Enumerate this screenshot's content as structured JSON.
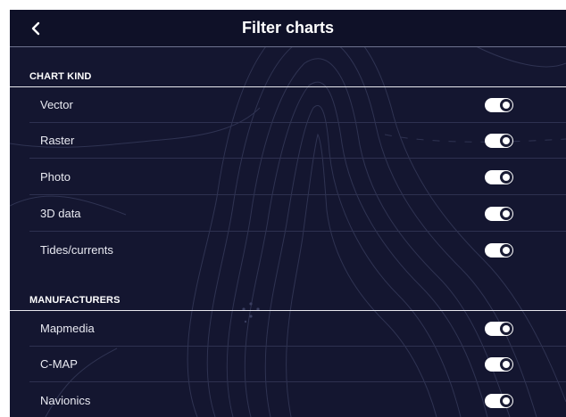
{
  "header": {
    "title": "Filter charts",
    "back_icon": "chevron-left-icon"
  },
  "sections": {
    "chart_kind": {
      "heading": "CHART KIND",
      "items": [
        {
          "label": "Vector",
          "enabled": true
        },
        {
          "label": "Raster",
          "enabled": true
        },
        {
          "label": "Photo",
          "enabled": true
        },
        {
          "label": "3D data",
          "enabled": true
        },
        {
          "label": "Tides/currents",
          "enabled": true
        }
      ]
    },
    "manufacturers": {
      "heading": "MANUFACTURERS",
      "items": [
        {
          "label": "Mapmedia",
          "enabled": true
        },
        {
          "label": "C-MAP",
          "enabled": true
        },
        {
          "label": "Navionics",
          "enabled": true
        }
      ]
    }
  },
  "colors": {
    "background": "#141630",
    "header": "#0f1128",
    "toggle_on": "#ffffff",
    "text": "#ffffff"
  }
}
